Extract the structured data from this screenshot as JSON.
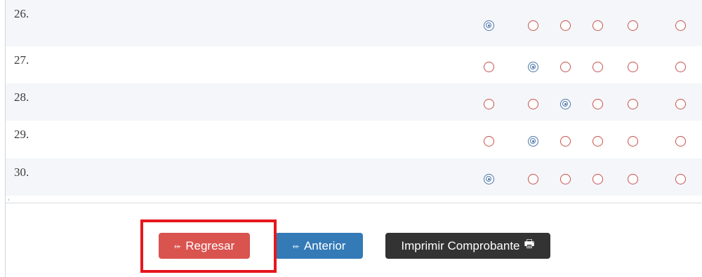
{
  "questions": [
    {
      "label": "26.",
      "selected": 0
    },
    {
      "label": "27.",
      "selected": 1
    },
    {
      "label": "28.",
      "selected": 2
    },
    {
      "label": "29.",
      "selected": 1
    },
    {
      "label": "30.",
      "selected": 0
    }
  ],
  "option_count": 6,
  "colors": {
    "selected_radio": "#4a74a8",
    "unselected_radio": "#c9504d",
    "regresar": "#d9534f",
    "anterior": "#337ab7",
    "imprimir": "#333333",
    "highlight": "#e6161d"
  },
  "buttons": {
    "regresar_label": "Regresar",
    "regresar_icon": "arrow-left-icon",
    "anterior_label": "Anterior",
    "anterior_icon": "arrow-left-icon",
    "imprimir_label": "Imprimir Comprobante",
    "imprimir_icon": "printer-icon"
  },
  "scroll_indicator": "‹"
}
